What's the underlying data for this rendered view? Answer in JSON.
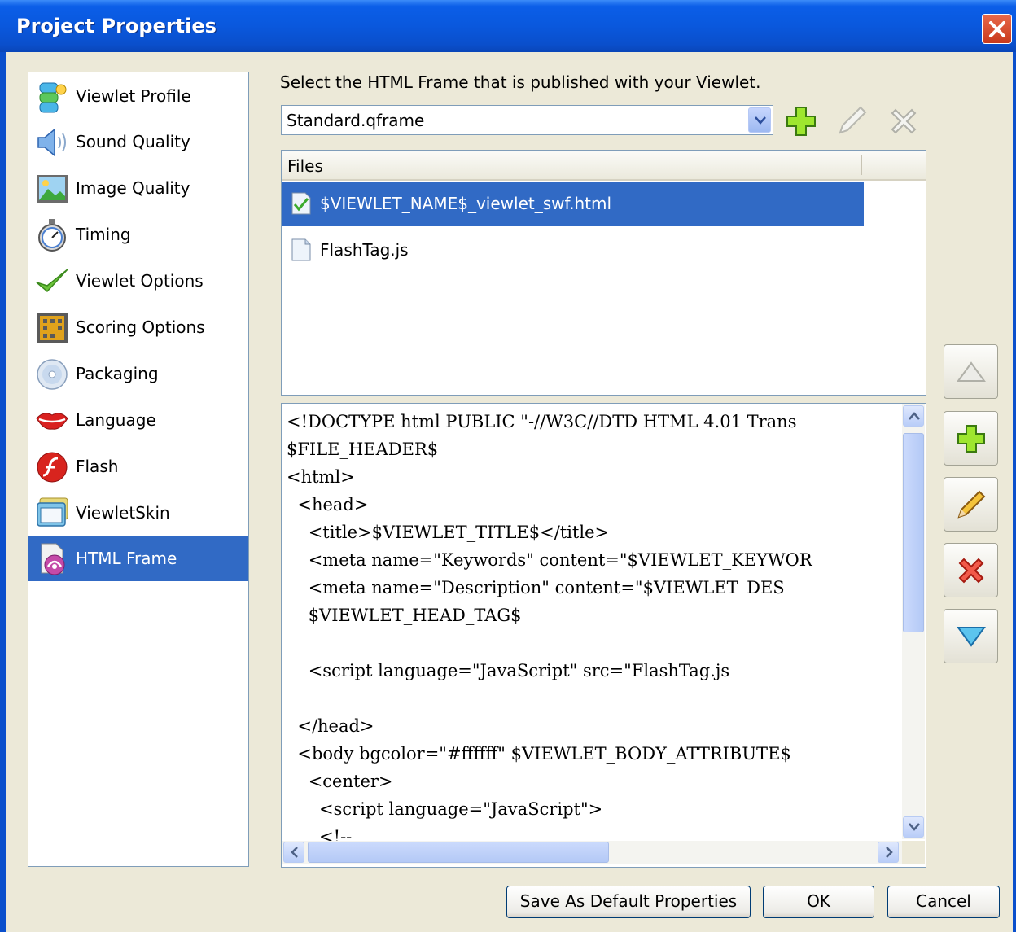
{
  "window": {
    "title": "Project Properties"
  },
  "sidebar": {
    "items": [
      {
        "label": "Viewlet Profile",
        "icon": "viewlet-profile-icon"
      },
      {
        "label": "Sound Quality",
        "icon": "speaker-icon"
      },
      {
        "label": "Image Quality",
        "icon": "picture-icon"
      },
      {
        "label": "Timing",
        "icon": "stopwatch-icon"
      },
      {
        "label": "Viewlet Options",
        "icon": "checkmark-icon"
      },
      {
        "label": "Scoring Options",
        "icon": "scoreboard-icon"
      },
      {
        "label": "Packaging",
        "icon": "disc-icon"
      },
      {
        "label": "Language",
        "icon": "lips-icon"
      },
      {
        "label": "Flash",
        "icon": "flash-icon"
      },
      {
        "label": "ViewletSkin",
        "icon": "skin-window-icon"
      },
      {
        "label": "HTML Frame",
        "icon": "html-frame-icon",
        "selected": true
      }
    ]
  },
  "main": {
    "prompt": "Select the HTML Frame that is published with your Viewlet.",
    "frame_select": {
      "value": "Standard.qframe"
    },
    "files": {
      "header": "Files",
      "rows": [
        {
          "name": "$VIEWLET_NAME$_viewlet_swf.html",
          "selected": true
        },
        {
          "name": "FlashTag.js",
          "selected": false
        }
      ]
    },
    "code_lines": [
      "<!DOCTYPE html PUBLIC \"-//W3C//DTD HTML 4.01 Trans",
      "$FILE_HEADER$",
      "<html>",
      "  <head>",
      "    <title>$VIEWLET_TITLE$</title>",
      "    <meta name=\"Keywords\" content=\"$VIEWLET_KEYWOR",
      "    <meta name=\"Description\" content=\"$VIEWLET_DES",
      "    $VIEWLET_HEAD_TAG$",
      "",
      "    <script language=\"JavaScript\" src=\"FlashTag.js",
      "",
      "  </head>",
      "  <body bgcolor=\"#ffffff\" $VIEWLET_BODY_ATTRIBUTE$",
      "    <center>",
      "      <script language=\"JavaScript\">",
      "      <!--"
    ]
  },
  "buttons": {
    "save_default": "Save As Default Properties",
    "ok": "OK",
    "cancel": "Cancel"
  },
  "colors": {
    "titlebar": "#0a58dd",
    "selection": "#316ac5",
    "dialog_bg": "#ece9d8"
  }
}
